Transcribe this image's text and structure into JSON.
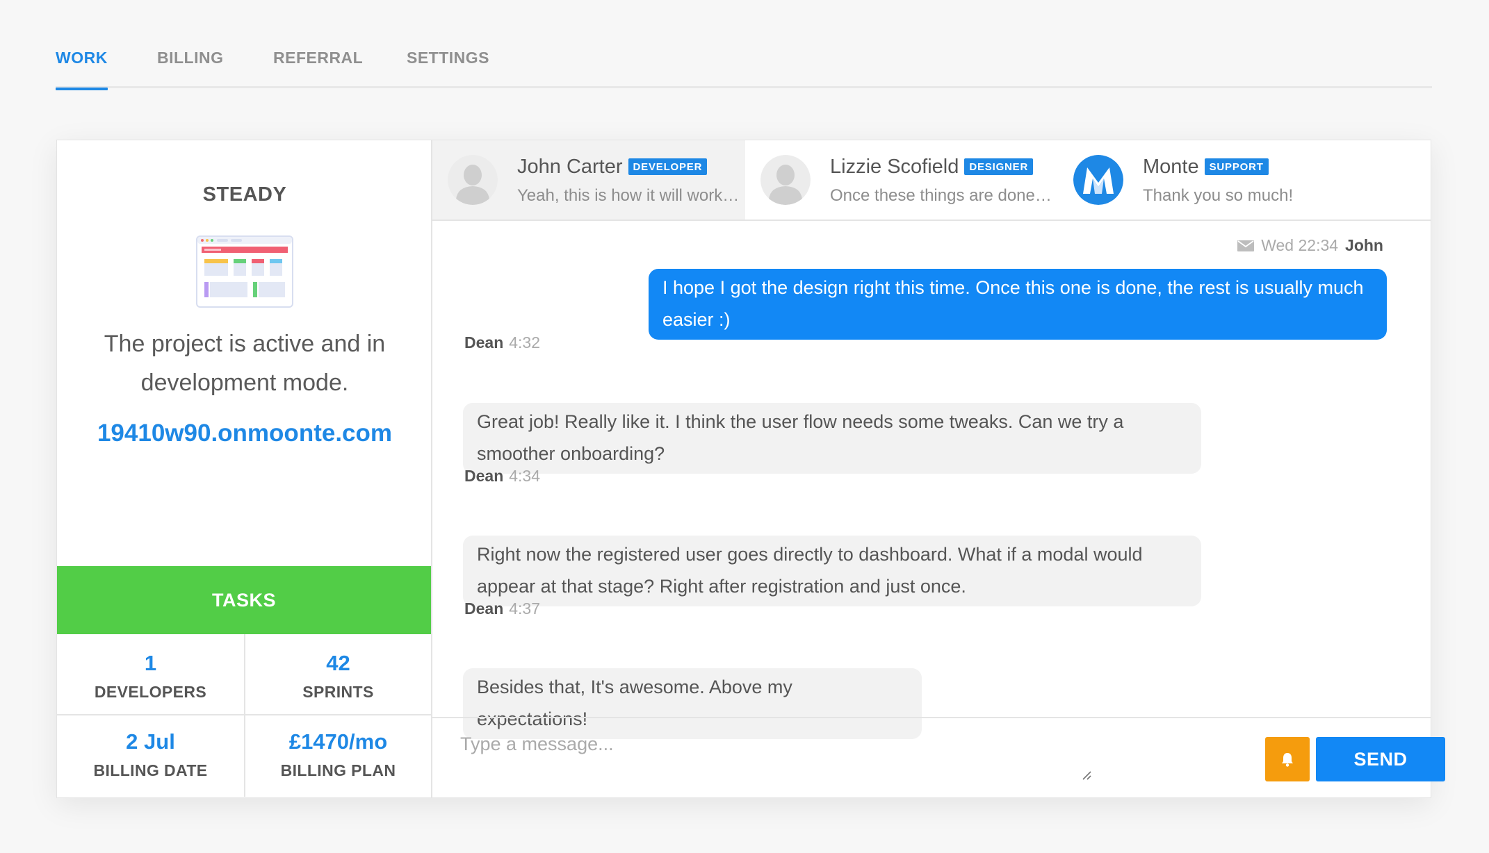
{
  "tabs": [
    {
      "label": "WORK",
      "active": true
    },
    {
      "label": "BILLING",
      "active": false
    },
    {
      "label": "REFERRAL",
      "active": false
    },
    {
      "label": "SETTINGS",
      "active": false
    }
  ],
  "project": {
    "name": "STEADY",
    "illustration_icon": "browser-dashboard-illustration",
    "description": "The project is active and in development mode.",
    "url": "19410w90.onmoonte.com",
    "tasks_label": "TASKS",
    "stats": [
      {
        "value": "1",
        "label": "DEVELOPERS"
      },
      {
        "value": "42",
        "label": "SPRINTS"
      },
      {
        "value": "2 Jul",
        "label": "BILLING DATE"
      },
      {
        "value": "£1470/mo",
        "label": "BILLING PLAN"
      }
    ]
  },
  "contacts": [
    {
      "name": "John Carter",
      "role": "DEVELOPER",
      "preview": "Yeah, this is how it will work…",
      "avatar": "user-placeholder-icon",
      "active": true
    },
    {
      "name": "Lizzie Scofield",
      "role": "DESIGNER",
      "preview": "Once these things are done…",
      "avatar": "user-placeholder-icon",
      "active": false
    },
    {
      "name": "Monte",
      "role": "SUPPORT",
      "preview": "Thank you so much!",
      "avatar": "monte-logo-icon",
      "active": false
    }
  ],
  "messages": [
    {
      "sender": "John",
      "time": "Wed 22:34",
      "own": true,
      "icon": "mail-icon",
      "text": "I hope I got the design right this time. Once this one is done, the rest is usually much easier :)"
    },
    {
      "sender": "Dean",
      "time": "4:32",
      "own": false,
      "text": "Great job! Really like it. I think the user flow needs some tweaks. Can we try a smoother onboarding?"
    },
    {
      "sender": "Dean",
      "time": "4:34",
      "own": false,
      "text": "Right now the registered user goes directly to dashboard. What if a modal would appear at that stage? Right after registration and just once."
    },
    {
      "sender": "Dean",
      "time": "4:37",
      "own": false,
      "text": "Besides that, It's awesome. Above my expectations!"
    }
  ],
  "composer": {
    "placeholder": "Type a message...",
    "send_label": "SEND",
    "notify_icon": "bell-icon"
  },
  "colors": {
    "accent": "#1e88e5",
    "own_bubble": "#1288f5",
    "tasks_green": "#52cd47",
    "bell_orange": "#f59c0d"
  }
}
